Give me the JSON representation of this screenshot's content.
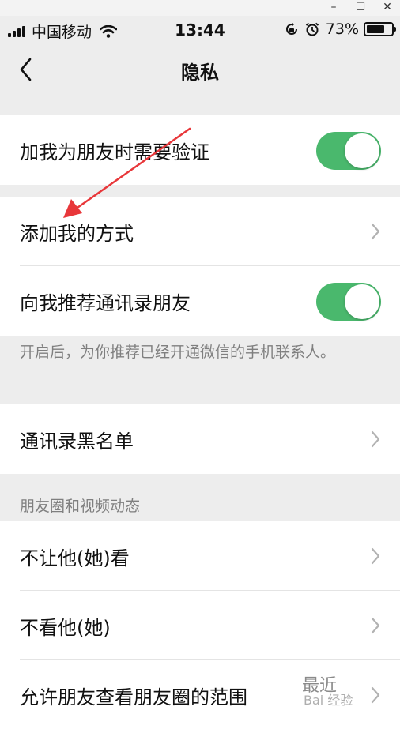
{
  "window_controls": {
    "minimize": "–",
    "maximize": "☐",
    "close": "✕"
  },
  "status_bar": {
    "carrier": "中国移动",
    "time": "13:44",
    "battery_percent": "73%",
    "battery_level": 0.73,
    "icons": [
      "signal-icon",
      "wifi-icon",
      "rotation-lock-icon",
      "alarm-icon",
      "battery-icon"
    ]
  },
  "nav": {
    "title": "隐私",
    "back_icon": "chevron-left-icon"
  },
  "settings": {
    "verify_friend": {
      "label": "加我为朋友时需要验证",
      "enabled": true
    },
    "add_methods": {
      "label": "添加我的方式"
    },
    "recommend_contacts": {
      "label": "向我推荐通讯录朋友",
      "enabled": true
    },
    "recommend_note": "开启后，为你推荐已经开通微信的手机联系人。",
    "blacklist": {
      "label": "通讯录黑名单"
    },
    "moments_section_title": "朋友圈和视频动态",
    "hide_from": {
      "label": "不让他(她)看"
    },
    "hide_their": {
      "label": "不看他(她)"
    },
    "moments_range": {
      "label": "允许朋友查看朋友圈的范围",
      "value": "最近"
    }
  },
  "watermark": {
    "text": "Bai 经验"
  },
  "colors": {
    "toggle_on": "#4ab86d",
    "background": "#ededed",
    "arrow": "#e8373a",
    "note_text": "#7f7f7f"
  }
}
